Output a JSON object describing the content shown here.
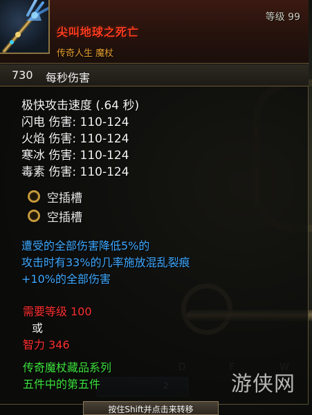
{
  "item": {
    "name": "尖叫地球之死亡",
    "type": "传奇人生 魔杖",
    "level_tag": "等级 99"
  },
  "dps": {
    "value": "730",
    "label": "每秒伤害"
  },
  "stats": [
    "极快攻击速度 (.64 秒)",
    "闪电 伤害: 110-124",
    "火焰 伤害: 110-124",
    "寒冰 伤害: 110-124",
    "毒素 伤害: 110-124"
  ],
  "sockets": [
    "空插槽",
    "空插槽"
  ],
  "bonuses": [
    "遭受的全部伤害降低5%的",
    "攻击时有33%的几率施放混乱裂痕",
    "+10%的全部伤害"
  ],
  "requirements": {
    "level": "需要等级 100",
    "or": "或",
    "intellect": "智力 346"
  },
  "set": [
    "传奇魔杖藏品系列",
    "五件中的第五件"
  ],
  "hint": "按住Shift并点击来转移",
  "background": {
    "slot_letters": [
      "D",
      "F",
      "W"
    ],
    "slot_number": "2"
  },
  "watermark": "游侠网",
  "colors": {
    "item_name": "#ff3b1f",
    "item_type": "#e8a030",
    "magic_bonus": "#3ea8ff",
    "requirement": "#ff3030",
    "set_text": "#3ee33e",
    "socket_ring": "#c79a3a"
  },
  "icons": {
    "item": "trident-wand-icon",
    "socket": "empty-socket-ring-icon"
  }
}
